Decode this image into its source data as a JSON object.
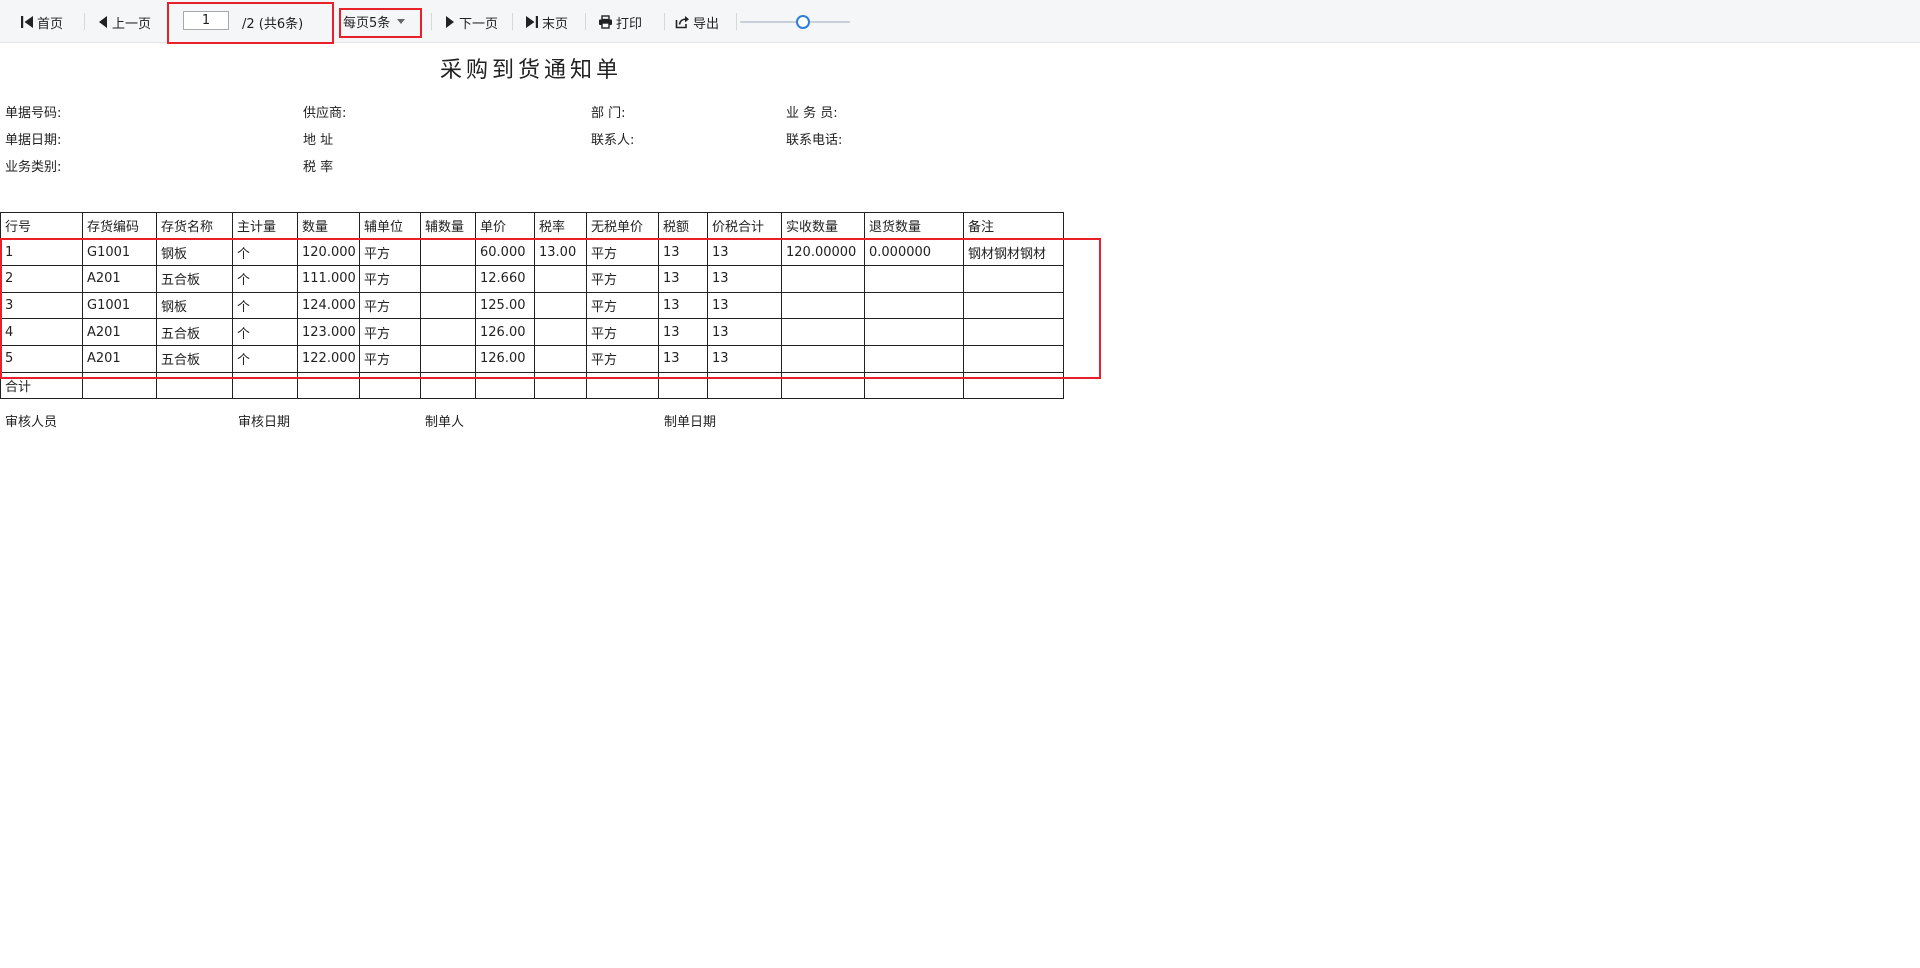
{
  "toolbar": {
    "first_label": "首页",
    "prev_label": "上一页",
    "current_page": "1",
    "page_info": "/2   (共6条)",
    "per_page_label": "每页5条",
    "next_label": "下一页",
    "last_label": "末页",
    "print_label": "打印",
    "export_label": "导出",
    "zoom": 0.57
  },
  "report": {
    "title": "采购到货通知单",
    "fields": {
      "doc_no": "单据号码:",
      "supplier": "供应商:",
      "department": "部   门:",
      "salesman": "业 务 员:",
      "doc_date": "单据日期:",
      "address": "地    址",
      "contact": "联系人:",
      "phone": "联系电话:",
      "biz_type": "业务类别:",
      "tax_rate": "税    率"
    },
    "columns": [
      "行号",
      "存货编码",
      "存货名称",
      "主计量",
      "数量",
      "辅单位",
      "辅数量",
      "单价",
      "税率",
      "无税单价",
      "税额",
      "价税合计",
      "实收数量",
      "退货数量",
      "备注"
    ],
    "rows": [
      [
        "1",
        "G1001",
        "钢板",
        "个",
        "120.000",
        "平方",
        "",
        "60.000",
        "13.00",
        "平方",
        "13",
        "13",
        "120.00000",
        "0.000000",
        "钢材钢材钢材"
      ],
      [
        "2",
        "A201",
        "五合板",
        "个",
        "111.000",
        "平方",
        "",
        "12.660",
        "",
        "平方",
        "13",
        "13",
        "",
        "",
        ""
      ],
      [
        "3",
        "G1001",
        "钢板",
        "个",
        "124.000",
        "平方",
        "",
        "125.00",
        "",
        "平方",
        "13",
        "13",
        "",
        "",
        ""
      ],
      [
        "4",
        "A201",
        "五合板",
        "个",
        "123.000",
        "平方",
        "",
        "126.00",
        "",
        "平方",
        "13",
        "13",
        "",
        "",
        ""
      ],
      [
        "5",
        "A201",
        "五合板",
        "个",
        "122.000",
        "平方",
        "",
        "126.00",
        "",
        "平方",
        "13",
        "13",
        "",
        "",
        ""
      ]
    ],
    "total_label": "合计",
    "footer": {
      "reviewer": "审核人员",
      "review_date": "审核日期",
      "maker": "制单人",
      "make_date": "制单日期"
    }
  },
  "colors": {
    "highlight": "#e8202a",
    "slider_accent": "#2f7ed8"
  }
}
